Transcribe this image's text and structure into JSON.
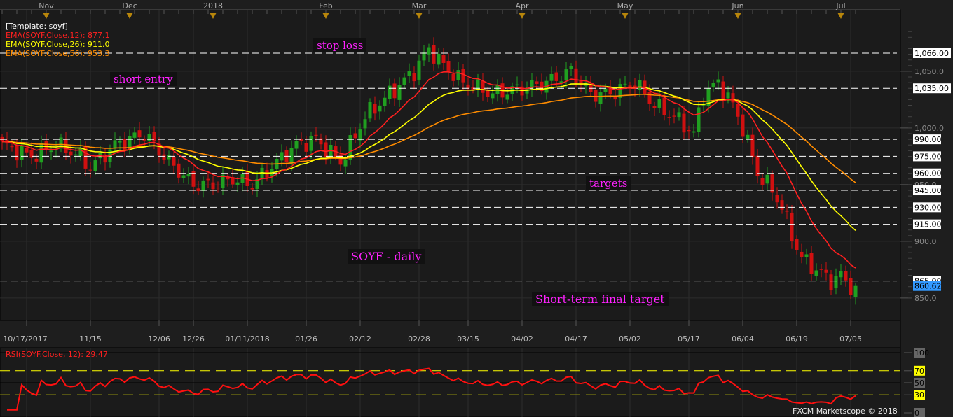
{
  "legend": {
    "template": "[Template: soyf]",
    "ema12": "EMA(SOYF.Close,12): 877.1",
    "ema26": "EMA(SOYF.Close,26): 911.0",
    "ema56": "EMA(SOYF.Close,56): 953.3"
  },
  "annotations": {
    "stop_loss": "stop loss",
    "short_entry": "short entry",
    "targets": "targets",
    "title": "SOYF - daily",
    "final_target": "Short-term final target"
  },
  "rsi": {
    "legend": "RSI(SOYF.Close, 12): 29.47"
  },
  "copyright": "FXCM Marketscope © 2018",
  "colors": {
    "ema12": "#ff2020",
    "ema26": "#ffff00",
    "ema56": "#ff8c00",
    "up": "#20a020",
    "down": "#d01010",
    "last": "#3399ff"
  },
  "chart_data": {
    "type": "candlestick",
    "symbol": "SOYF",
    "timeframe": "daily",
    "ylim": [
      835,
      1090
    ],
    "price_ticks": [
      "1,050.0",
      "1,000.0",
      "950.0",
      "900.0",
      "850.0"
    ],
    "price_tick_values": [
      1050,
      1000,
      950,
      900,
      850
    ],
    "levels": [
      1066,
      1035,
      990,
      975,
      960,
      945,
      930,
      915,
      865
    ],
    "level_labels": [
      "1,066.00",
      "1,035.00",
      "990.00",
      "975.00",
      "960.00",
      "945.00",
      "930.00",
      "915.00",
      "865.00"
    ],
    "last_price": 860.62,
    "last_price_label": "860.62",
    "candle_count": 175,
    "close_anchors": [
      [
        0,
        985
      ],
      [
        6,
        975
      ],
      [
        11,
        985
      ],
      [
        16,
        975
      ],
      [
        18,
        965
      ],
      [
        23,
        985
      ],
      [
        29,
        995
      ],
      [
        31,
        985
      ],
      [
        34,
        970
      ],
      [
        39,
        950
      ],
      [
        43,
        950
      ],
      [
        47,
        955
      ],
      [
        51,
        950
      ],
      [
        56,
        970
      ],
      [
        60,
        985
      ],
      [
        64,
        990
      ],
      [
        69,
        970
      ],
      [
        71,
        985
      ],
      [
        74,
        1010
      ],
      [
        79,
        1030
      ],
      [
        84,
        1050
      ],
      [
        87,
        1070
      ],
      [
        90,
        1055
      ],
      [
        94,
        1040
      ],
      [
        100,
        1030
      ],
      [
        106,
        1035
      ],
      [
        111,
        1040
      ],
      [
        116,
        1050
      ],
      [
        120,
        1030
      ],
      [
        124,
        1030
      ],
      [
        129,
        1040
      ],
      [
        133,
        1020
      ],
      [
        137,
        1010
      ],
      [
        141,
        995
      ],
      [
        143,
        1030
      ],
      [
        146,
        1040
      ],
      [
        149,
        1020
      ],
      [
        151,
        1000
      ],
      [
        154,
        960
      ],
      [
        157,
        945
      ],
      [
        159,
        930
      ],
      [
        161,
        905
      ],
      [
        163,
        885
      ],
      [
        166,
        875
      ],
      [
        169,
        865
      ],
      [
        171,
        870
      ],
      [
        174,
        855
      ]
    ],
    "month_labels": [
      [
        "Nov",
        9
      ],
      [
        "Dec",
        26
      ],
      [
        "2018",
        43
      ],
      [
        "Feb",
        66
      ],
      [
        "Mar",
        85
      ],
      [
        "Apr",
        106
      ],
      [
        "May",
        127
      ],
      [
        "Jun",
        150
      ],
      [
        "Jul",
        171
      ]
    ],
    "date_labels": [
      [
        "10/17/2017",
        5
      ],
      [
        "11/15",
        18
      ],
      [
        "12/06",
        32
      ],
      [
        "12/26",
        39
      ],
      [
        "01/11/2018",
        50
      ],
      [
        "01/26",
        62
      ],
      [
        "02/12",
        73
      ],
      [
        "02/28",
        85
      ],
      [
        "03/15",
        95
      ],
      [
        "04/02",
        106
      ],
      [
        "04/17",
        117
      ],
      [
        "05/02",
        128
      ],
      [
        "05/17",
        140
      ],
      [
        "06/04",
        151
      ],
      [
        "06/19",
        162
      ],
      [
        "07/05",
        173
      ]
    ],
    "rsi_period": 12,
    "rsi_levels": [
      70,
      30
    ],
    "rsi_ticks": [
      "100",
      "70",
      "50",
      "30",
      "0"
    ],
    "rsi_tick_values": [
      100,
      70,
      50,
      30,
      0
    ]
  }
}
